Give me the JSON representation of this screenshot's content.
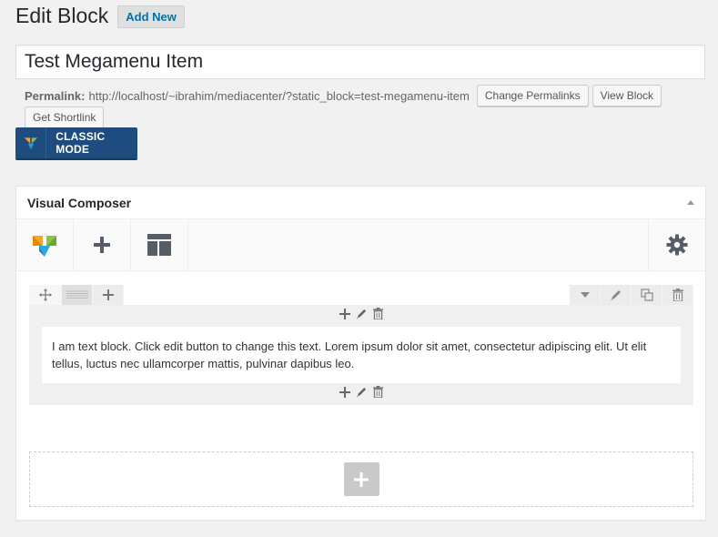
{
  "header": {
    "title": "Edit Block",
    "add_new": "Add New"
  },
  "post": {
    "title": "Test Megamenu Item"
  },
  "permalink": {
    "label": "Permalink:",
    "url": "http://localhost/~ibrahim/mediacenter/?static_block=test-megamenu-item",
    "change_button": "Change Permalinks",
    "view_button": "View Block",
    "shortlink_button": "Get Shortlink"
  },
  "classic_mode": {
    "label": "CLASSIC MODE"
  },
  "vc": {
    "title": "Visual Composer",
    "toolbar": [
      "vc-logo-icon",
      "plus-icon",
      "layout-icon",
      "gear-icon"
    ],
    "text_block": "I am text block. Click edit button to change this text. Lorem ipsum dolor sit amet, consectetur adipiscing elit. Ut elit tellus, luctus nec ullamcorper mattis, pulvinar dapibus leo."
  },
  "colors": {
    "classic_bg": "#1f4c7e",
    "link": "#0073aa",
    "icon": "#555d66"
  }
}
